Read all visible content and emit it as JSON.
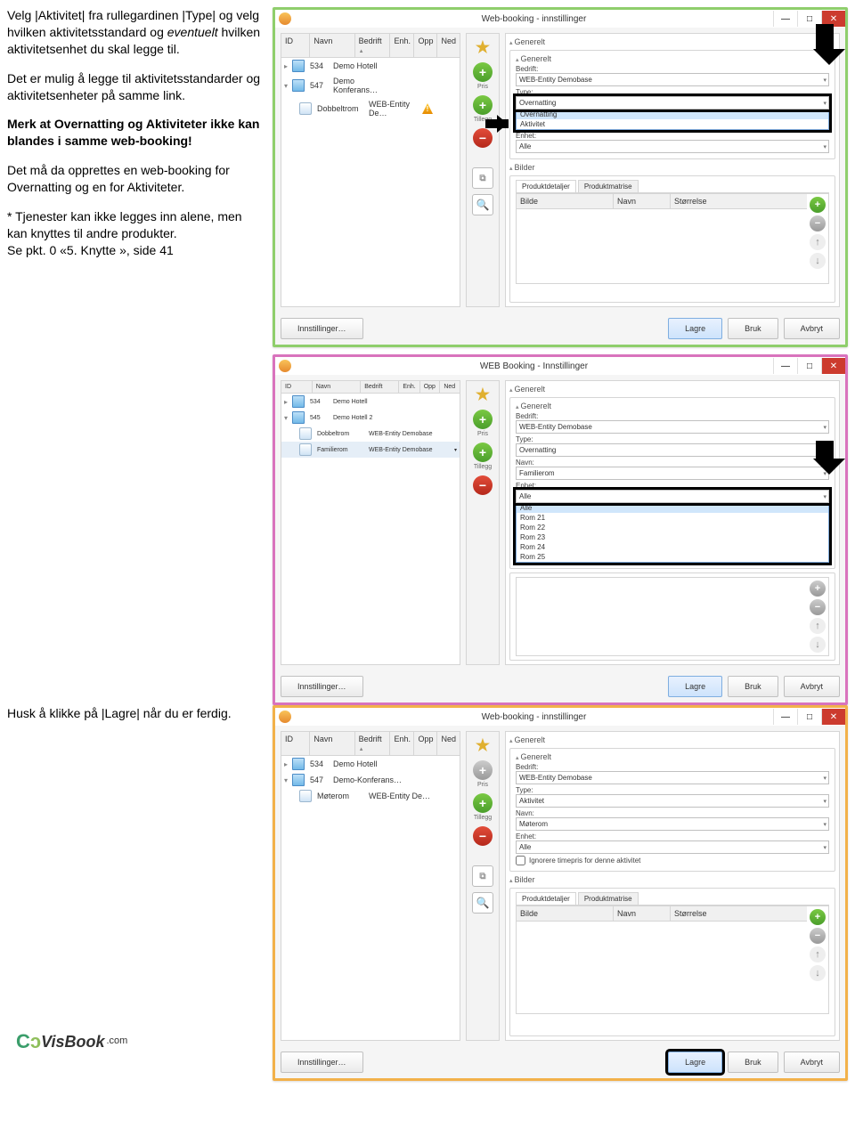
{
  "instructions": {
    "p1a": "Velg |Aktivitet| fra rullegardinen |Type| og velg hvilken aktivitetsstandard og ",
    "p1b": "eventuelt",
    "p1c": " hvilken aktivitetsenhet du skal legge til.",
    "p2": "Det er mulig å legge til aktivitetsstandarder og aktivitetsenheter på samme link.",
    "p3": "Merk at Overnatting og Aktiviteter ikke kan blandes i samme web-booking!",
    "p4": "Det må da opprettes en web-booking for Overnatting og en for Aktiviteter.",
    "p5a": "* Tjenester kan ikke legges inn alene, men kan knyttes til andre produkter.",
    "p5b": "Se pkt. 0 «5. Knytte », side 41",
    "p6": "Husk å klikke på |Lagre| når du er ferdig."
  },
  "common": {
    "titlebar": {
      "title": "Web-booking - innstillinger",
      "title_alt": "WEB Booking - Innstillinger",
      "min": "—",
      "max": "□",
      "close": "✕"
    },
    "tableCols": {
      "id": "ID",
      "navn": "Navn",
      "bedrift": "Bedrift",
      "enh": "Enh.",
      "opp": "Opp",
      "ned": "Ned"
    },
    "sidebar": {
      "pris": "Pris",
      "tillegg": "Tillegg"
    },
    "section": {
      "generelt": "Generelt",
      "bilder": "Bilder"
    },
    "labels": {
      "bedrift": "Bedrift:",
      "type": "Type:",
      "navn": "Navn:",
      "enhet": "Enhet:",
      "ignorer": "Ignorere timepris for denne aktivitet"
    },
    "tabs": {
      "detaljer": "Produktdetaljer",
      "matrise": "Produktmatrise"
    },
    "tableInner": {
      "bilde": "Bilde",
      "navn": "Navn",
      "storrelse": "Størrelse"
    },
    "footer": {
      "innst": "Innstillinger…",
      "lagre": "Lagre",
      "bruk": "Bruk",
      "avbryt": "Avbryt"
    }
  },
  "shot1": {
    "bedrift": "WEB-Entity Demobase",
    "typeOptions": [
      "Overnatting",
      "Overnatting",
      "Aktivitet"
    ],
    "enhetSel": "Alle",
    "rows": [
      {
        "id": "534",
        "navn": "Demo Hotell",
        "bedrift": ""
      },
      {
        "id": "547",
        "navn": "Demo Konferans…",
        "bedrift": ""
      },
      {
        "id": "",
        "navn": "Dobbeltrom",
        "bedrift": "WEB-Entity De…",
        "warn": true
      }
    ]
  },
  "shot2": {
    "bedrift": "WEB-Entity Demobase",
    "typeSel": "Overnatting",
    "navnSel": "Familierom",
    "enhetLabel": "Enhet:",
    "enhetOptions": [
      "Alle",
      "Alle",
      "Rom 21",
      "Rom 22",
      "Rom 23",
      "Rom 24",
      "Rom 25"
    ],
    "rows": [
      {
        "id": "534",
        "navn": "Demo Hotell",
        "bedrift": ""
      },
      {
        "id": "545",
        "navn": "Demo Hotell 2",
        "bedrift": ""
      },
      {
        "id": "",
        "navn": "Dobbeltrom",
        "bedrift": "WEB-Entity Demobase"
      },
      {
        "id": "",
        "navn": "Familierom",
        "bedrift": "WEB-Entity Demobase",
        "sel": true
      }
    ]
  },
  "shot3": {
    "bedrift": "WEB-Entity Demobase",
    "typeSel": "Aktivitet",
    "navnSel": "Møterom",
    "enhetSel": "Alle",
    "rows": [
      {
        "id": "534",
        "navn": "Demo Hotell",
        "bedrift": ""
      },
      {
        "id": "547",
        "navn": "Demo-Konferans…",
        "bedrift": ""
      },
      {
        "id": "",
        "navn": "Møterom",
        "bedrift": "WEB-Entity De…"
      }
    ]
  },
  "logo": {
    "brand": "VisBook",
    "dom": ".com"
  }
}
